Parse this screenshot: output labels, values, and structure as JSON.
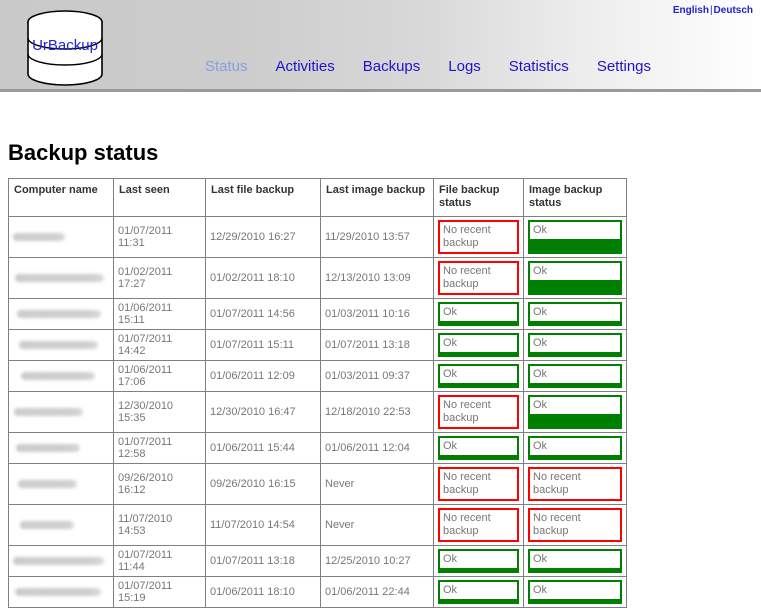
{
  "header": {
    "logo_text": "UrBackup",
    "languages": {
      "english": "English",
      "separator": "|",
      "deutsch": "Deutsch"
    },
    "nav": [
      {
        "label": "Status",
        "active": true
      },
      {
        "label": "Activities",
        "active": false
      },
      {
        "label": "Backups",
        "active": false
      },
      {
        "label": "Logs",
        "active": false
      },
      {
        "label": "Statistics",
        "active": false
      },
      {
        "label": "Settings",
        "active": false
      }
    ]
  },
  "page": {
    "title": "Backup status"
  },
  "table": {
    "columns": [
      "Computer name",
      "Last seen",
      "Last file backup",
      "Last image backup",
      "File backup status",
      "Image backup status"
    ],
    "rows": [
      {
        "computer_name": "",
        "last_seen": "01/07/2011 11:31",
        "last_file_backup": "12/29/2010 16:27",
        "last_image_backup": "11/29/2010 13:57",
        "file_backup_status": "No recent backup",
        "file_backup_state": "bad",
        "image_backup_status": "Ok",
        "image_backup_state": "ok",
        "tall": true
      },
      {
        "computer_name": "",
        "last_seen": "01/02/2011 17:27",
        "last_file_backup": "01/02/2011 18:10",
        "last_image_backup": "12/13/2010 13:09",
        "file_backup_status": "No recent backup",
        "file_backup_state": "bad",
        "image_backup_status": "Ok",
        "image_backup_state": "ok",
        "tall": true
      },
      {
        "computer_name": "",
        "last_seen": "01/06/2011 15:11",
        "last_file_backup": "01/07/2011 14:56",
        "last_image_backup": "01/03/2011 10:16",
        "file_backup_status": "Ok",
        "file_backup_state": "ok",
        "image_backup_status": "Ok",
        "image_backup_state": "ok",
        "tall": false
      },
      {
        "computer_name": "",
        "last_seen": "01/07/2011 14:42",
        "last_file_backup": "01/07/2011 15:11",
        "last_image_backup": "01/07/2011 13:18",
        "file_backup_status": "Ok",
        "file_backup_state": "ok",
        "image_backup_status": "Ok",
        "image_backup_state": "ok",
        "tall": false
      },
      {
        "computer_name": "",
        "last_seen": "01/06/2011 17:06",
        "last_file_backup": "01/06/2011 12:09",
        "last_image_backup": "01/03/2011 09:37",
        "file_backup_status": "Ok",
        "file_backup_state": "ok",
        "image_backup_status": "Ok",
        "image_backup_state": "ok",
        "tall": false
      },
      {
        "computer_name": "",
        "last_seen": "12/30/2010 15:35",
        "last_file_backup": "12/30/2010 16:47",
        "last_image_backup": "12/18/2010 22:53",
        "file_backup_status": "No recent backup",
        "file_backup_state": "bad",
        "image_backup_status": "Ok",
        "image_backup_state": "ok",
        "tall": true
      },
      {
        "computer_name": "",
        "last_seen": "01/07/2011 12:58",
        "last_file_backup": "01/06/2011 15:44",
        "last_image_backup": "01/06/2011 12:04",
        "file_backup_status": "Ok",
        "file_backup_state": "ok",
        "image_backup_status": "Ok",
        "image_backup_state": "ok",
        "tall": false
      },
      {
        "computer_name": "",
        "last_seen": "09/26/2010 16:12",
        "last_file_backup": "09/26/2010 16:15",
        "last_image_backup": "Never",
        "file_backup_status": "No recent backup",
        "file_backup_state": "bad",
        "image_backup_status": "No recent backup",
        "image_backup_state": "bad",
        "tall": true
      },
      {
        "computer_name": "",
        "last_seen": "11/07/2010 14:53",
        "last_file_backup": "11/07/2010 14:54",
        "last_image_backup": "Never",
        "file_backup_status": "No recent backup",
        "file_backup_state": "bad",
        "image_backup_status": "No recent backup",
        "image_backup_state": "bad",
        "tall": true
      },
      {
        "computer_name": "",
        "last_seen": "01/07/2011 11:44",
        "last_file_backup": "01/07/2011 13:18",
        "last_image_backup": "12/25/2010 10:27",
        "file_backup_status": "Ok",
        "file_backup_state": "ok",
        "image_backup_status": "Ok",
        "image_backup_state": "ok",
        "tall": false
      },
      {
        "computer_name": "",
        "last_seen": "01/07/2011 15:19",
        "last_file_backup": "01/06/2011 18:10",
        "last_image_backup": "01/06/2011 22:44",
        "file_backup_status": "Ok",
        "file_backup_state": "ok",
        "image_backup_status": "Ok",
        "image_backup_state": "ok",
        "tall": false
      }
    ]
  },
  "colors": {
    "ok": "#008000",
    "bad": "#ff0000",
    "link": "#2211cc",
    "link_active": "#8a9ee0",
    "logo_text": "#2222dd"
  }
}
